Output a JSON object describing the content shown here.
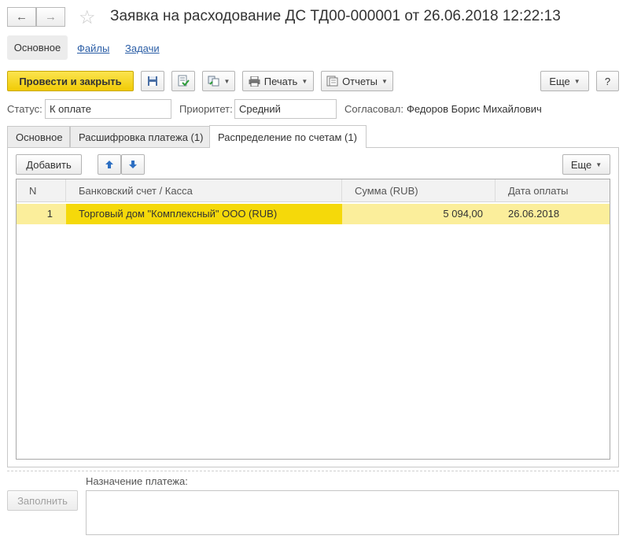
{
  "window": {
    "title": "Заявка на расходование ДС ТД00-000001 от 26.06.2018 12:22:13",
    "back_icon": "←",
    "forward_icon": "→",
    "favorite_icon": "☆"
  },
  "sections": {
    "active": "Основное",
    "links": [
      "Файлы",
      "Задачи"
    ]
  },
  "toolbar": {
    "post_and_close": "Провести и закрыть",
    "print": "Печать",
    "reports": "Отчеты",
    "more": "Еще",
    "help": "?"
  },
  "status_row": {
    "status_label": "Статус:",
    "status_value": "К оплате",
    "priority_label": "Приоритет:",
    "priority_value": "Средний",
    "approved_label": "Согласовал:",
    "approved_value": "Федоров Борис Михайлович"
  },
  "tabs": [
    "Основное",
    "Расшифровка платежа (1)",
    "Распределение по счетам (1)"
  ],
  "table_toolbar": {
    "add": "Добавить",
    "up_icon": "arrow-up",
    "down_icon": "arrow-down",
    "more": "Еще"
  },
  "table": {
    "columns": [
      "N",
      "Банковский счет / Касса",
      "Сумма (RUB)",
      "Дата оплаты"
    ],
    "rows": [
      {
        "n": "1",
        "account": "Торговый дом \"Комплексный\" ООО (RUB)",
        "amount": "5 094,00",
        "date": "26.06.2018"
      }
    ]
  },
  "bottom": {
    "fill_button": "Заполнить",
    "purpose_label": "Назначение платежа:",
    "purpose_value": ""
  },
  "colors": {
    "accent_yellow": "#f5d90a",
    "row_highlight": "#fbee9b",
    "link_blue": "#2b5ea6"
  }
}
